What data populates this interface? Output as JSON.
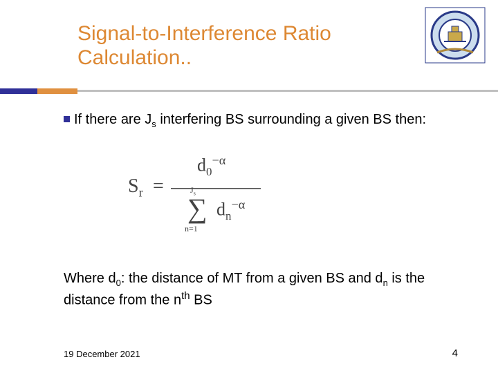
{
  "title_line1": "Signal-to-Interference Ratio",
  "title_line2": "Calculation..",
  "bullet": {
    "pre": "If there are J",
    "sub1": "s",
    "post": " interfering BS surrounding a given BS then:"
  },
  "formula": {
    "S": "S",
    "S_sub": "r",
    "eq": "=",
    "d": "d",
    "num_sub": "0",
    "num_sup": "−α",
    "sigma": "∑",
    "upper_J": "J",
    "upper_s": "s",
    "lower": "n=1",
    "den_sub": "n",
    "den_sup": "−α"
  },
  "where": {
    "pre": "Where d",
    "d0": "0",
    "mid1": ": the distance of MT from a given BS and d",
    "dn": "n",
    "mid2": " is the distance from the n",
    "th": "th",
    "post": " BS"
  },
  "footer": {
    "date": "19 December 2021",
    "page": "4"
  }
}
